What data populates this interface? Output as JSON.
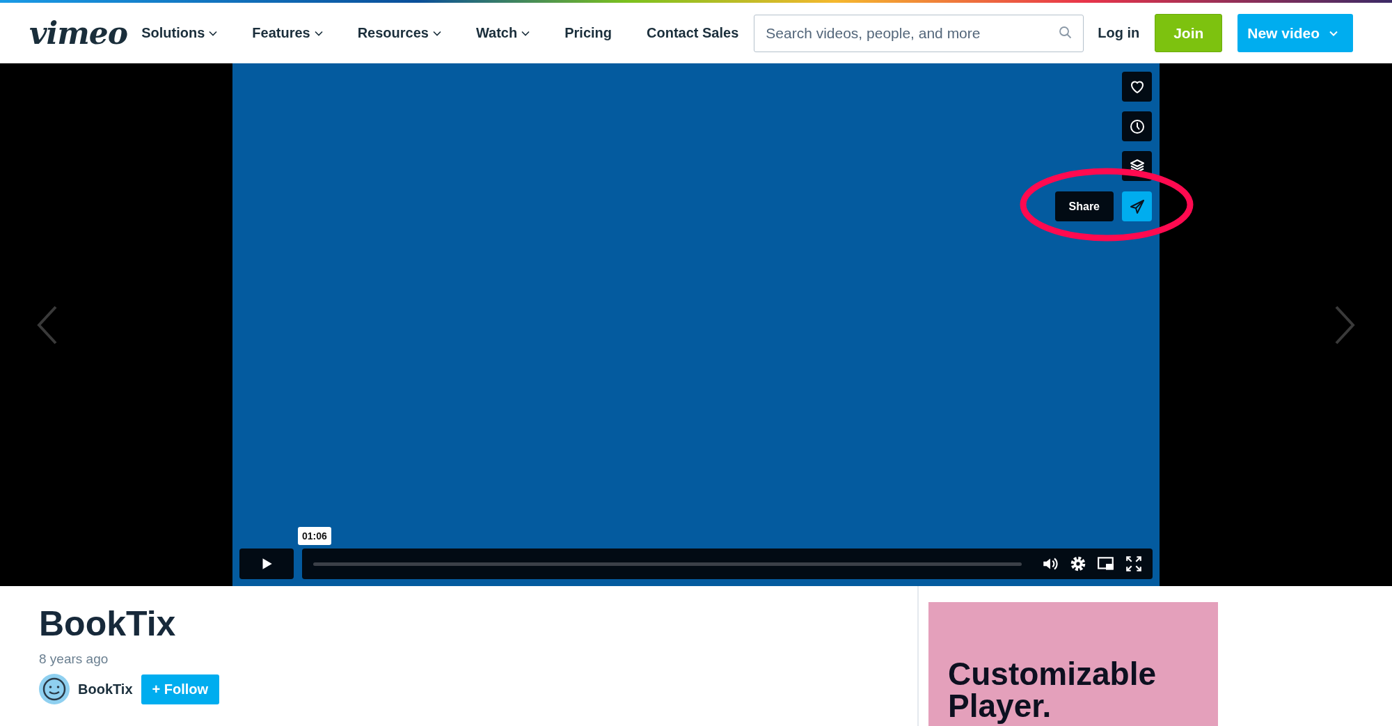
{
  "header": {
    "logo": "vimeo",
    "nav": [
      {
        "label": "Solutions",
        "dropdown": true
      },
      {
        "label": "Features",
        "dropdown": true
      },
      {
        "label": "Resources",
        "dropdown": true
      },
      {
        "label": "Watch",
        "dropdown": true
      },
      {
        "label": "Pricing",
        "dropdown": false
      },
      {
        "label": "Contact Sales",
        "dropdown": false
      }
    ],
    "search": {
      "placeholder": "Search videos, people, and more"
    },
    "login": "Log in",
    "join": "Join",
    "new_video": "New video"
  },
  "player": {
    "share_label": "Share",
    "time_tooltip": "01:06"
  },
  "video": {
    "title": "BookTix",
    "age": "8 years ago",
    "channel": "BookTix",
    "follow": "+ Follow"
  },
  "ad": {
    "text": "Customizable Player."
  }
}
